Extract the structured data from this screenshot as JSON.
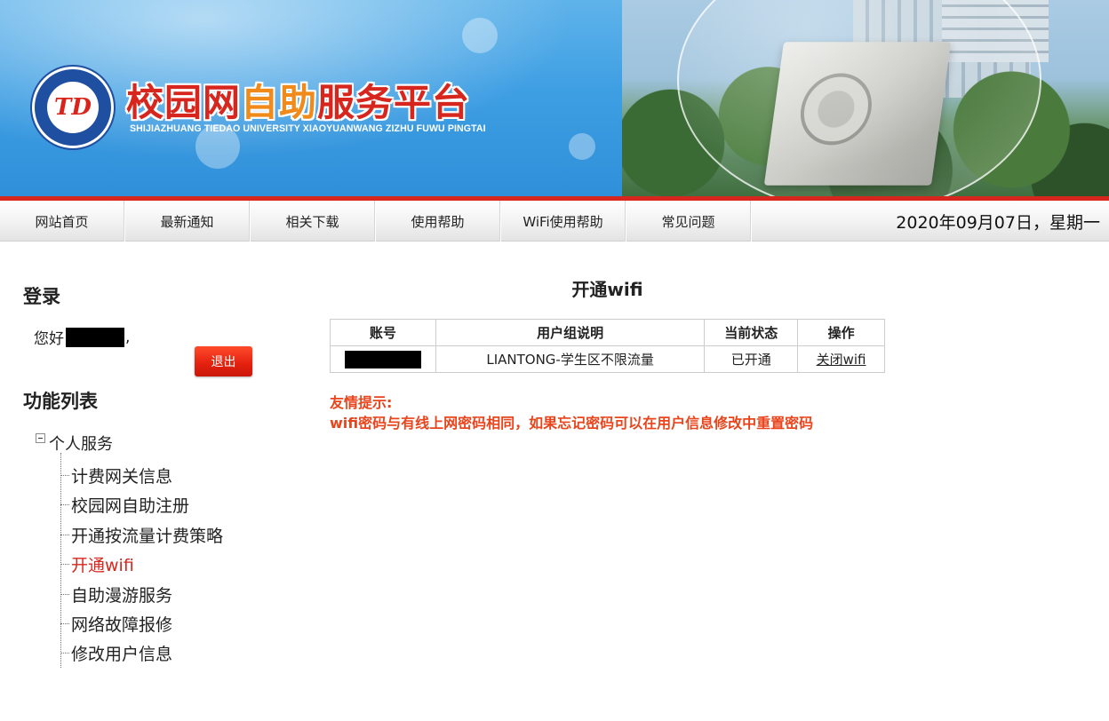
{
  "header": {
    "title_part1": "校园网",
    "title_part2": "自助",
    "title_part3": "服务平台",
    "subtitle": "SHIJIAZHUANG TIEDAO UNIVERSITY XIAOYUANWANG ZIZHU FUWU PINGTAI",
    "logo_mark": "TD"
  },
  "nav": {
    "items": [
      "网站首页",
      "最新通知",
      "相关下载",
      "使用帮助",
      "WiFi使用帮助",
      "常见问题"
    ],
    "date": "2020年09月07日，星期一"
  },
  "sidebar": {
    "login_title": "登录",
    "greeting_prefix": "您好",
    "greeting_suffix": ",",
    "logout_label": "退出",
    "function_title": "功能列表",
    "tree_root": "个人服务",
    "tree_items": [
      "计费网关信息",
      "校园网自助注册",
      "开通按流量计费策略",
      "开通wifi",
      "自助漫游服务",
      "网络故障报修",
      "修改用户信息"
    ],
    "active_item": "开通wifi"
  },
  "main": {
    "title": "开通wifi",
    "table": {
      "headers": [
        "账号",
        "用户组说明",
        "当前状态",
        "操作"
      ],
      "rows": [
        {
          "group": "LIANTONG-学生区不限流量",
          "status": "已开通",
          "action": "关闭wifi"
        }
      ]
    },
    "tip_title": "友情提示:",
    "tip_text": "wifi密码与有线上网密码相同，如果忘记密码可以在用户信息修改中重置密码"
  },
  "colors": {
    "accent_red": "#d7261e",
    "tip_orange": "#e8451d",
    "banner_blue": "#3f9fe3"
  },
  "icons": {
    "tree_toggle": "tree-collapse-icon",
    "logo": "university-logo"
  }
}
